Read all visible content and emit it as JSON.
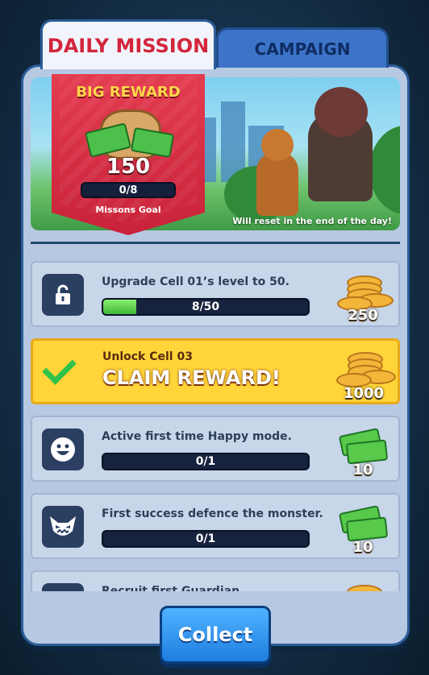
{
  "tabs": {
    "daily": "DAILY MISSION",
    "campaign": "CAMPAIGN"
  },
  "banner": {
    "title": "BIG REWARD",
    "amount": "150",
    "progress": "0/8",
    "goal_label": "Missons Goal",
    "reset_text": "Will reset in the end of the day!"
  },
  "missions": [
    {
      "title": "Upgrade Cell 01’s level to 50.",
      "progress": "8/50",
      "progress_fraction": 0.16,
      "reward": "250",
      "reward_type": "coin",
      "icon": "unlock-icon"
    },
    {
      "title": "Unlock Cell 03",
      "action": "CLAIM REWARD!",
      "reward": "1000",
      "reward_type": "coin",
      "icon": "check-icon",
      "claimable": true
    },
    {
      "title": "Active first time Happy mode.",
      "progress": "0/1",
      "progress_fraction": 0,
      "reward": "10",
      "reward_type": "cash",
      "icon": "happy-face-icon"
    },
    {
      "title": "First success defence the monster.",
      "progress": "0/1",
      "progress_fraction": 0,
      "reward": "10",
      "reward_type": "cash",
      "icon": "monster-face-icon"
    },
    {
      "title": "Recruit first Guardian",
      "reward_type": "coin",
      "icon": "guardian-icon"
    }
  ],
  "collect_label": "Collect",
  "colors": {
    "accent_red": "#d2263c",
    "claim_yellow": "#ffd53a",
    "progress_green": "#3fb63a",
    "button_blue": "#1f7ee0"
  }
}
